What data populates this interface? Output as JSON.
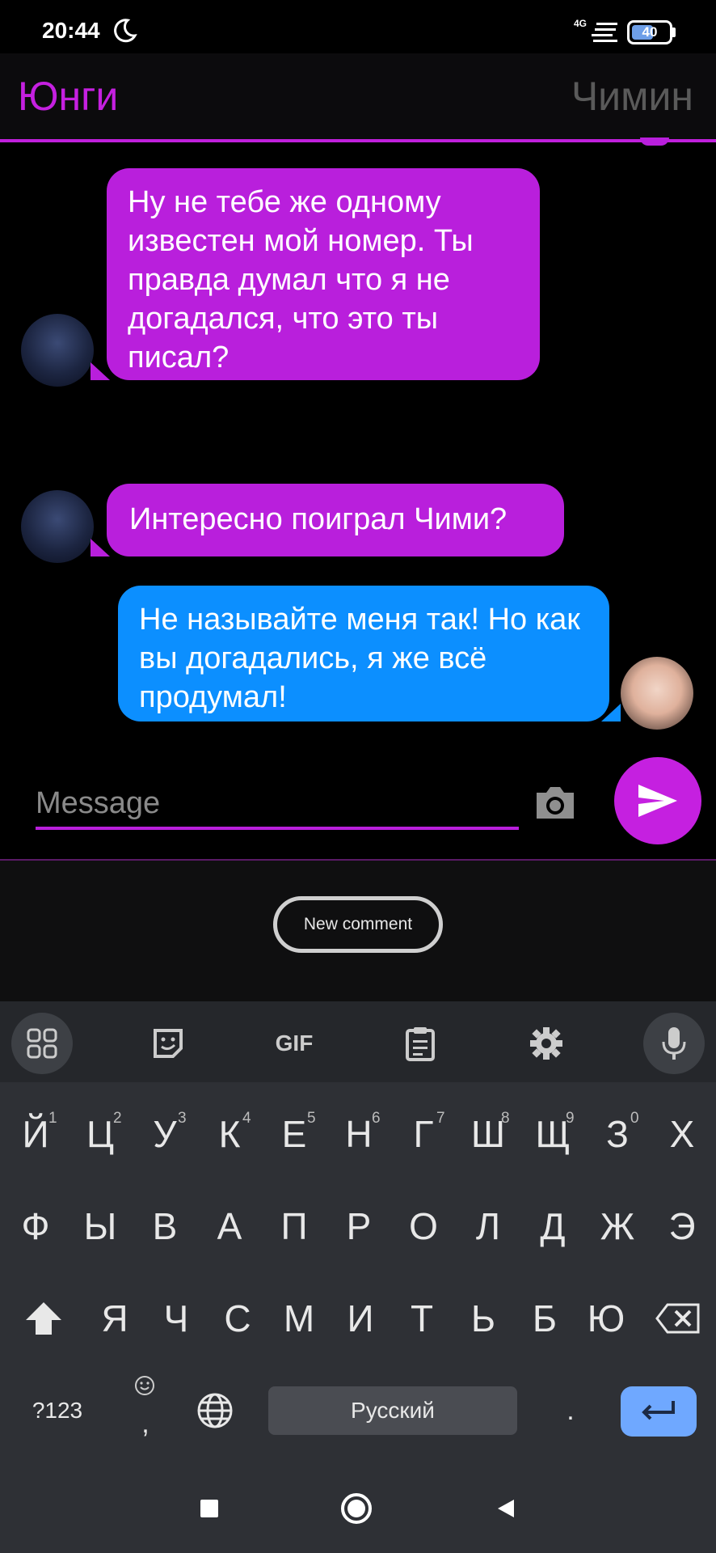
{
  "status_bar": {
    "time": "20:44",
    "network": "4G",
    "battery": "40"
  },
  "header": {
    "left_name": "Юнги",
    "right_name": "Чимин"
  },
  "messages": [
    {
      "text": "Ну не тебе же одному известен мой номер. Ты правда думал что я не догадался, что это ты писал?"
    },
    {
      "text": "Интересно поиграл Чими?"
    },
    {
      "text": "Не называйте меня так! Но как вы догадались, я же всё продумал!"
    }
  ],
  "input": {
    "placeholder": "Message"
  },
  "comment": {
    "button_label": "New comment"
  },
  "keyboard": {
    "toolbar": [
      "apps-icon",
      "sticker-icon",
      "gif",
      "clipboard-icon",
      "settings-icon",
      "mic-icon"
    ],
    "gif_label": "GIF",
    "row1": [
      "Й",
      "Ц",
      "У",
      "К",
      "Е",
      "Н",
      "Г",
      "Ш",
      "Щ",
      "З",
      "Х"
    ],
    "row1_hints": [
      "1",
      "2",
      "3",
      "4",
      "5",
      "6",
      "7",
      "8",
      "9",
      "0"
    ],
    "row2": [
      "Ф",
      "Ы",
      "В",
      "А",
      "П",
      "Р",
      "О",
      "Л",
      "Д",
      "Ж",
      "Э"
    ],
    "row3": [
      "Я",
      "Ч",
      "С",
      "М",
      "И",
      "Т",
      "Ь",
      "Б",
      "Ю"
    ],
    "symbols_label": "?123",
    "comma_label": ",",
    "space_label": "Русский",
    "period_label": "."
  },
  "colors": {
    "accent_purple": "#c520e0",
    "bubble_purple": "#b91fdc",
    "bubble_blue": "#0c8fff",
    "enter_key": "#6fa8ff"
  }
}
